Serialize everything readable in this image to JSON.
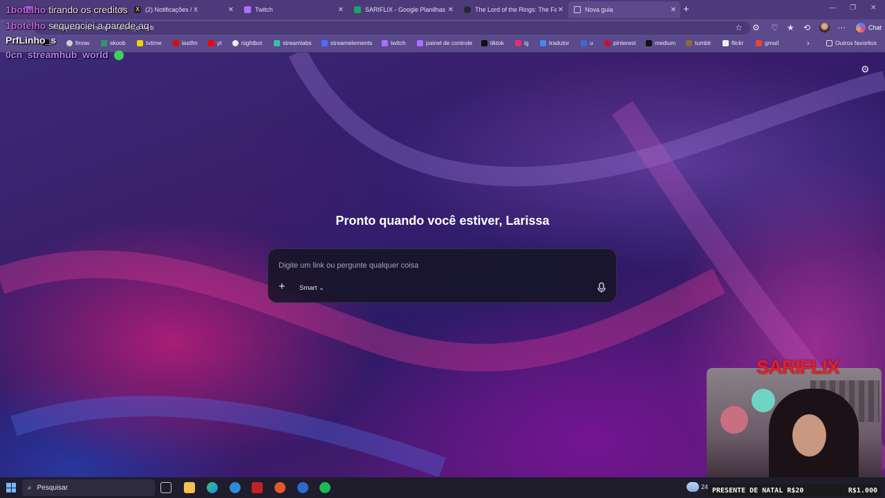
{
  "tabs": [
    {
      "title": "",
      "active": false,
      "icon": "twitch-icon",
      "color": "#a970ff"
    },
    {
      "title": "(2) Notificações / X",
      "active": false,
      "icon": "x-icon",
      "color": "#222222"
    },
    {
      "title": "Twitch",
      "active": false,
      "icon": "twitch-icon",
      "color": "#a970ff"
    },
    {
      "title": "SARIFLIX - Google Planilhas",
      "active": false,
      "icon": "sheets-icon",
      "color": "#1ea362"
    },
    {
      "title": "The Lord of the Rings: The Fellows",
      "active": false,
      "icon": "letterboxd-icon",
      "color": "#202830"
    },
    {
      "title": "Nova guia",
      "active": true,
      "icon": "newtab-icon",
      "color": "#8a7ab8"
    }
  ],
  "address_bar": {
    "value": "Pesquisar ou inserir endereço web"
  },
  "toolbar": {
    "chat_label": "Chat"
  },
  "bookmarks": [
    {
      "label": "",
      "icon": "x-icon",
      "color": "#111111"
    },
    {
      "label": "fmow",
      "icon": "globe-icon",
      "color": "#cfcfcf"
    },
    {
      "label": "skoob",
      "icon": "skoob-icon",
      "color": "#2a9a6a"
    },
    {
      "label": "tvtime",
      "icon": "tvtime-icon",
      "color": "#f6d000"
    },
    {
      "label": "lastfm",
      "icon": "lastfm-icon",
      "color": "#d51007"
    },
    {
      "label": "yt",
      "icon": "youtube-icon",
      "color": "#ff0000"
    },
    {
      "label": "nightbot",
      "icon": "nightbot-icon",
      "color": "#eeeeee"
    },
    {
      "label": "streamlabs",
      "icon": "streamlabs-icon",
      "color": "#31c3a2"
    },
    {
      "label": "streamelements",
      "icon": "streamelements-icon",
      "color": "#4a6cff"
    },
    {
      "label": "twitch",
      "icon": "twitch-icon",
      "color": "#a970ff"
    },
    {
      "label": "painel de controle",
      "icon": "twitch-icon",
      "color": "#a970ff"
    },
    {
      "label": "tiktok",
      "icon": "tiktok-icon",
      "color": "#111111"
    },
    {
      "label": "ig",
      "icon": "instagram-icon",
      "color": "#e1306c"
    },
    {
      "label": "tradutor",
      "icon": "translate-icon",
      "color": "#4285f4"
    },
    {
      "label": "u",
      "icon": "u-icon",
      "color": "#3a6ad0"
    },
    {
      "label": "pinterest",
      "icon": "pinterest-icon",
      "color": "#e60023"
    },
    {
      "label": "medium",
      "icon": "medium-icon",
      "color": "#111111"
    },
    {
      "label": "tumblr",
      "icon": "tumblr-icon",
      "color": "#8a6a3a"
    },
    {
      "label": "flickr",
      "icon": "flickr-icon",
      "color": "#eeeeee"
    },
    {
      "label": "gmail",
      "icon": "gmail-icon",
      "color": "#ea4335"
    },
    {
      "label": "Outros favoritos",
      "icon": "folder-icon",
      "color": "#e8e4f4"
    }
  ],
  "stream_chat": [
    {
      "name": "1botelho",
      "message": "tirando os creditos",
      "name_color": "#c060e0"
    },
    {
      "name": "1botelho",
      "message": "sequenciei a parede aq",
      "name_color": "#c060e0"
    },
    {
      "name": "PrfLinho_s",
      "message": "",
      "name_color": "#f0f0f0"
    },
    {
      "name": "0cn_streamhub_world",
      "message": "",
      "name_color": "#b080f0"
    }
  ],
  "main": {
    "greeting": "Pronto quando você estiver, Larissa",
    "prompt_placeholder": "Digite um link ou pergunte qualquer coisa",
    "mode_label": "Smart"
  },
  "overlay": {
    "brand": "SARIFLIX",
    "banner_left": "PRESENTE DE NATAL R$20",
    "banner_right": "R$1.000"
  },
  "taskbar": {
    "search_label": "Pesquisar",
    "temp": "24"
  },
  "colors": {
    "accent": "#5b4a8c",
    "tabstrip": "#4c3a7a",
    "brand_red": "#e0202a"
  }
}
